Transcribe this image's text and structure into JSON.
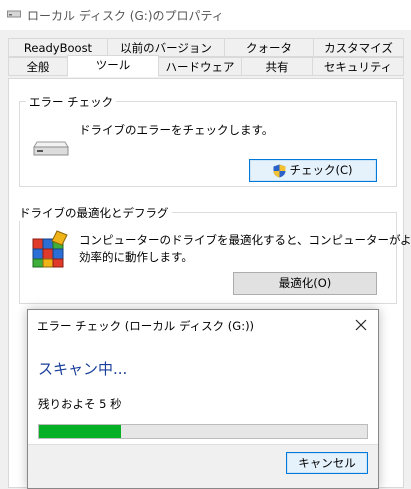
{
  "window": {
    "title": "ローカル ディスク (G:)のプロパティ",
    "icon": "drive-icon"
  },
  "tabs": {
    "row_back": [
      "ReadyBoost",
      "以前のバージョン",
      "クォータ",
      "カスタマイズ"
    ],
    "row_front": [
      "全般",
      "ツール",
      "ハードウェア",
      "共有",
      "セキュリティ"
    ],
    "active": "ツール"
  },
  "error_check": {
    "group_title": "エラー チェック",
    "description": "ドライブのエラーをチェックします。",
    "button_label": "チェック(C)",
    "button_icon": "uac-shield-icon",
    "icon": "hard-drive-icon"
  },
  "optimize": {
    "group_title": "ドライブの最適化とデフラグ",
    "description_line1": "コンピューターのドライブを最適化すると、コンピューターがより",
    "description_line2": "効率的に動作します。",
    "button_label": "最適化(O)",
    "icon": "defrag-icon"
  },
  "scan_dialog": {
    "title": "エラー チェック (ローカル ディスク (G:))",
    "heading": "スキャン中...",
    "remaining": "残りおよそ 5 秒",
    "progress_fraction": 0.25,
    "cancel_label": "キャンセル",
    "close_icon": "close-icon"
  },
  "colors": {
    "progress": "#06b025",
    "heading": "#1a3f9a",
    "focus_border": "#0078d7"
  }
}
